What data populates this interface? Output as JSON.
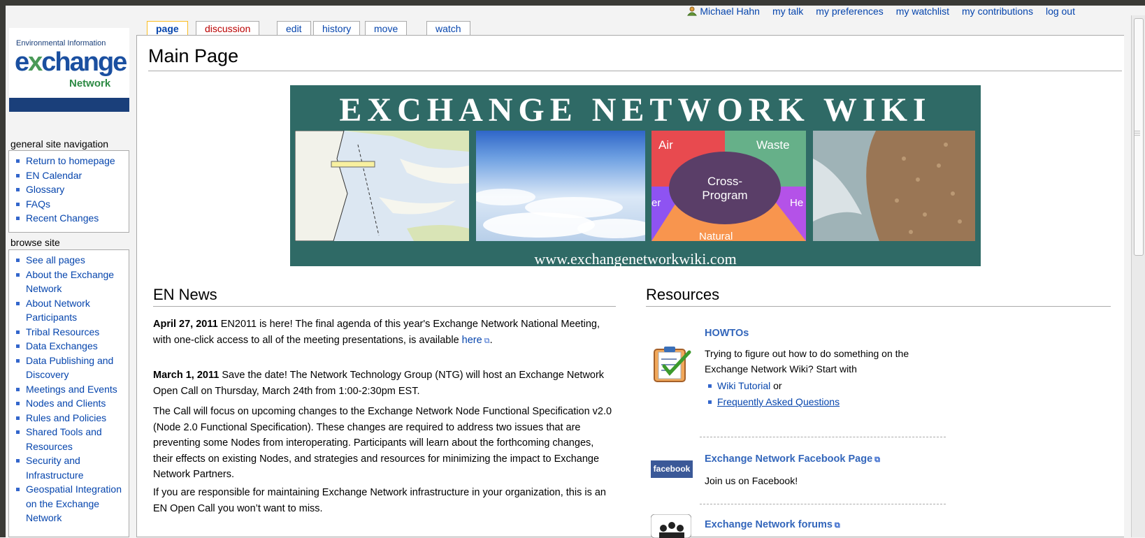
{
  "personal_tools": {
    "user": "Michael Hahn",
    "items": [
      "my talk",
      "my preferences",
      "my watchlist",
      "my contributions",
      "log out"
    ]
  },
  "logo": {
    "line1": "Environmental Information",
    "line2_a": "e",
    "line2_x": "x",
    "line2_b": "change",
    "line3": "Network"
  },
  "tabs": [
    "page",
    "discussion",
    "edit",
    "history",
    "move",
    "watch"
  ],
  "sidebar": {
    "nav_title": "general site navigation",
    "nav_items": [
      "Return to homepage",
      "EN Calendar",
      "Glossary",
      "FAQs",
      "Recent Changes"
    ],
    "browse_title": "browse site",
    "browse_items": [
      "See all pages",
      "About the Exchange Network",
      "About Network Participants",
      "Tribal Resources",
      "Data Exchanges",
      "Data Publishing and Discovery",
      "Meetings and Events",
      "Nodes and Clients",
      "Rules and Policies",
      "Shared Tools and Resources",
      "Security and Infrastructure",
      "Geospatial Integration on the Exchange Network"
    ]
  },
  "page_title": "Main Page",
  "banner": {
    "title": "EXCHANGE NETWORK WIKI",
    "url": "www.exchangenetworkwiki.com",
    "pie_labels": {
      "air": "Air",
      "waste": "Waste",
      "center": "Cross-\nProgram",
      "left": "er",
      "right": "He",
      "bottom": "Natural"
    },
    "colors": {
      "air": "#e84a4f",
      "waste": "#66b089",
      "water": "#8e53f2",
      "health": "#b452e8",
      "natural": "#f8954e",
      "center": "#5a3e68"
    }
  },
  "news": {
    "heading": "EN News",
    "item1_date": "April 27, 2011",
    "item1_text": " EN2011 is here! The final agenda of this year's Exchange Network National Meeting, with one-click access to all of the meeting presentations, is available ",
    "item1_link": "here",
    "item1_end": ".",
    "item2_date": "March 1, 2011",
    "item2_text": " Save the date! The Network Technology Group (NTG) will host an Exchange Network Open Call on Thursday, March 24th from 1:00-2:30pm EST.",
    "item3_text": "The Call will focus on upcoming changes to the Exchange Network Node Functional Specification v2.0 (Node 2.0 Functional Specification). These changes are required to address two issues that are preventing some Nodes from interoperating. Participants will learn about the forthcoming changes, their effects on existing Nodes, and strategies and resources for minimizing the impact to Exchange Network Partners.",
    "item4_text": "If you are responsible for maintaining Exchange Network infrastructure in your organization, this is an EN Open Call you won’t want to miss."
  },
  "resources": {
    "heading": "Resources",
    "howto_title": "HOWTOs",
    "howto_text": "Trying to figure out how to do something on the Exchange Network Wiki? Start with",
    "howto_link1": "Wiki Tutorial",
    "howto_or": " or",
    "howto_link2": "Frequently Asked Questions",
    "fb_title": "Exchange Network Facebook Page",
    "fb_text": "Join us on Facebook!",
    "fb_icon_text": "facebook",
    "forum_title": "Exchange Network forums"
  }
}
